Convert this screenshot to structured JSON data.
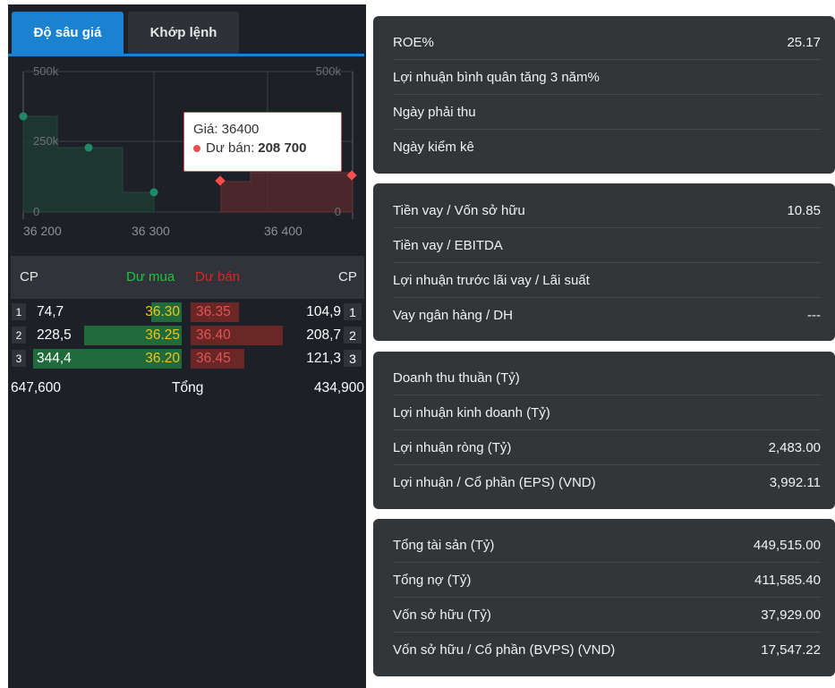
{
  "tabs": {
    "depth": "Độ sâu giá",
    "match": "Khớp lệnh"
  },
  "depth_chart": {
    "y_left": [
      "500k",
      "250k",
      "0"
    ],
    "y_right": [
      "500k",
      "0"
    ],
    "x_ticks": [
      "36 200",
      "36 300",
      "36 400"
    ],
    "buy_color": "#1f6b3c",
    "sell_color": "#6b2626",
    "tooltip": {
      "price_label": "Giá: 36400",
      "series_label": "Dư bán:",
      "value": "208 700"
    }
  },
  "orderbook": {
    "header": {
      "cp_left": "CP",
      "buy": "Dư mua",
      "sell": "Dư bán",
      "cp_right": "CP"
    },
    "rows": [
      {
        "level": "1",
        "buy_vol": "74,7",
        "buy_price": "36.30",
        "sell_price": "36.35",
        "sell_vol": "104,9",
        "level_r": "1",
        "buy_fill": 0.22,
        "sell_fill": 0.48
      },
      {
        "level": "2",
        "buy_vol": "228,5",
        "buy_price": "36.25",
        "sell_price": "36.40",
        "sell_vol": "208,7",
        "level_r": "2",
        "buy_fill": 0.66,
        "sell_fill": 0.96
      },
      {
        "level": "3",
        "buy_vol": "344,4",
        "buy_price": "36.20",
        "sell_price": "36.45",
        "sell_vol": "121,3",
        "level_r": "3",
        "buy_fill": 1.0,
        "sell_fill": 0.56
      }
    ],
    "total": {
      "buy": "647,600",
      "label": "Tổng",
      "sell": "434,900"
    }
  },
  "metrics": {
    "panel1": [
      {
        "label": "ROE%",
        "value": "25.17"
      },
      {
        "label": "Lợi nhuận bình quân tăng 3 năm%",
        "value": ""
      },
      {
        "label": "Ngày phải thu",
        "value": ""
      },
      {
        "label": "Ngày kiểm kê",
        "value": ""
      }
    ],
    "panel2": [
      {
        "label": "Tiền vay / Vốn sở hữu",
        "value": "10.85"
      },
      {
        "label": "Tiền vay / EBITDA",
        "value": ""
      },
      {
        "label": "Lợi nhuận trước lãi vay / Lãi suất",
        "value": ""
      },
      {
        "label": "Vay ngân hàng / DH",
        "value": "---"
      }
    ],
    "panel3": [
      {
        "label": "Doanh thu thuần (Tỷ)",
        "value": ""
      },
      {
        "label": "Lợi nhuận kinh doanh (Tỷ)",
        "value": ""
      },
      {
        "label": "Lợi nhuận ròng (Tỷ)",
        "value": "2,483.00"
      },
      {
        "label": "Lợi nhuận / Cổ phần (EPS) (VND)",
        "value": "3,992.11"
      }
    ],
    "panel4": [
      {
        "label": "Tổng tài sản (Tỷ)",
        "value": "449,515.00"
      },
      {
        "label": "Tổng nợ (Tỷ)",
        "value": "411,585.40"
      },
      {
        "label": "Vốn sở hữu (Tỷ)",
        "value": "37,929.00"
      },
      {
        "label": "Vốn sở hữu / Cổ phần (BVPS) (VND)",
        "value": "17,547.22"
      }
    ]
  }
}
